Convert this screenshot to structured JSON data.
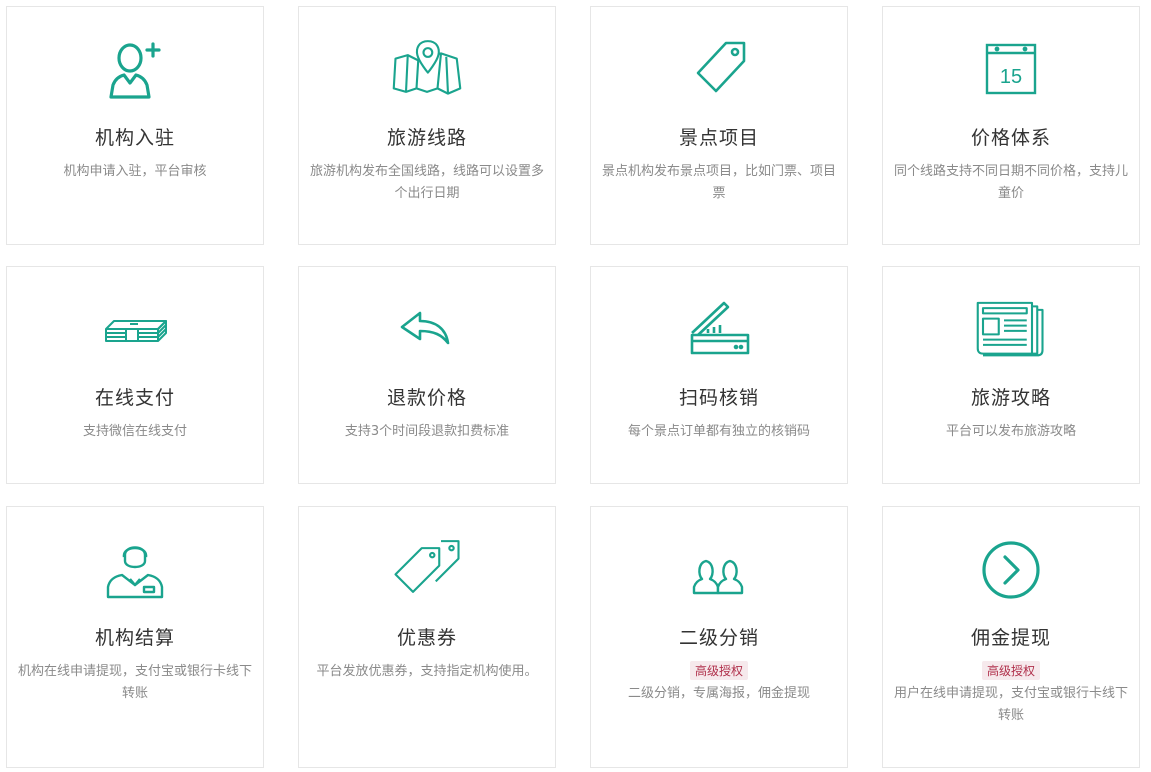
{
  "accent": "#1aa48e",
  "cards": [
    {
      "icon": "user-add-icon",
      "title": "机构入驻",
      "desc": "机构申请入驻，平台审核"
    },
    {
      "icon": "map-pin-icon",
      "title": "旅游线路",
      "desc": "旅游机构发布全国线路，线路可以设置多个出行日期"
    },
    {
      "icon": "tag-icon",
      "title": "景点项目",
      "desc": "景点机构发布景点项目，比如门票、项目票"
    },
    {
      "icon": "calendar-icon",
      "calendar_day": "15",
      "title": "价格体系",
      "desc": "同个线路支持不同日期不同价格，支持儿童价"
    },
    {
      "icon": "cash-icon",
      "title": "在线支付",
      "desc": "支持微信在线支付"
    },
    {
      "icon": "reply-arrow-icon",
      "title": "退款价格",
      "desc": "支持3个时间段退款扣费标准"
    },
    {
      "icon": "scanner-icon",
      "title": "扫码核销",
      "desc": "每个景点订单都有独立的核销码"
    },
    {
      "icon": "newspaper-icon",
      "title": "旅游攻略",
      "desc": "平台可以发布旅游攻略"
    },
    {
      "icon": "staff-icon",
      "title": "机构结算",
      "desc": "机构在线申请提现，支付宝或银行卡线下转账"
    },
    {
      "icon": "tags-icon",
      "title": "优惠券",
      "desc": "平台发放优惠券，支持指定机构使用。"
    },
    {
      "icon": "users-icon",
      "title": "二级分销",
      "badge": "高级授权",
      "desc": "二级分销，专属海报，佣金提现"
    },
    {
      "icon": "chevron-circle-icon",
      "title": "佣金提现",
      "badge": "高级授权",
      "desc": "用户在线申请提现，支付宝或银行卡线下转账"
    }
  ]
}
